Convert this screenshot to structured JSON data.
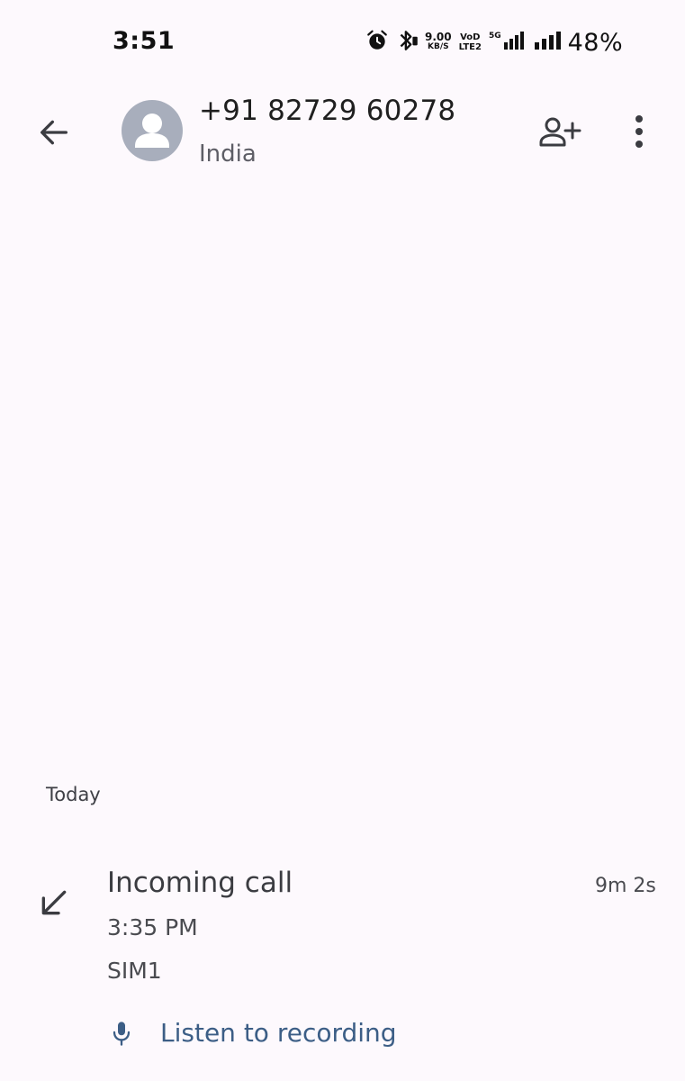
{
  "status_bar": {
    "time": "3:51",
    "net_speed_value": "9.00",
    "net_speed_unit": "KB/S",
    "volte_top": "VoD",
    "volte_bottom": "LTE2",
    "network_type": "5G",
    "battery": "48%",
    "icons": [
      "alarm-icon",
      "bluetooth-icon",
      "signal-icon",
      "signal-icon"
    ]
  },
  "header": {
    "number": "+91 82729 60278",
    "country": "India",
    "back_icon": "arrow-back-icon",
    "add_contact_icon": "person-add-icon",
    "more_icon": "more-vert-icon"
  },
  "history": {
    "date_header": "Today",
    "call": {
      "type": "Incoming call",
      "duration": "9m 2s",
      "time": "3:35 PM",
      "sim": "SIM1",
      "recording_label": "Listen to recording"
    }
  },
  "colors": {
    "background": "#FDF9FD",
    "avatar": "#A8AEBC",
    "link": "#3C5E86"
  }
}
